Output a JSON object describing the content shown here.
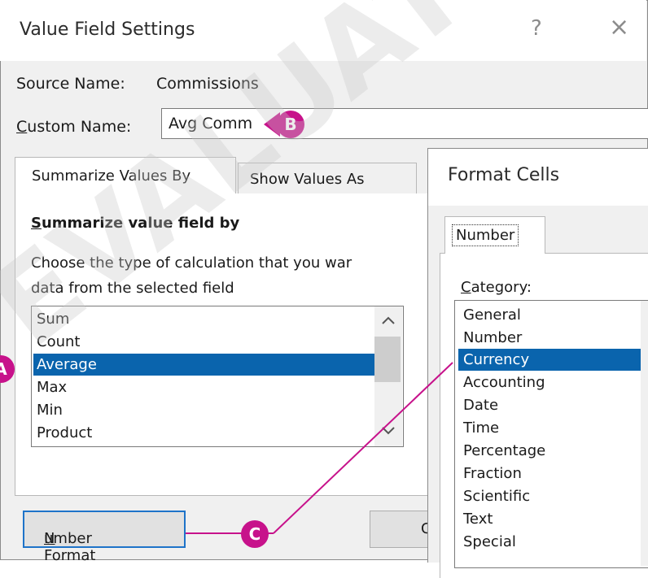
{
  "window": {
    "title": "Value Field Settings",
    "help_glyph": "?",
    "close_glyph": "×"
  },
  "source_row": {
    "label": "Source Name:",
    "value": "Commissions"
  },
  "custom_row": {
    "label_first": "C",
    "label_rest": "ustom Name:",
    "value": "Avg Comm"
  },
  "tabs": [
    {
      "label": "Summarize Values By"
    },
    {
      "label": "Show Values As"
    }
  ],
  "summarize": {
    "heading_first": "S",
    "heading_rest": "ummarize value field by",
    "desc_line1": "Choose the type of calculation that you war",
    "desc_line2": "data from the selected field",
    "items": [
      "Sum",
      "Count",
      "Average",
      "Max",
      "Min",
      "Product"
    ],
    "selected": "Average"
  },
  "buttons": {
    "number_format_first": "N",
    "number_format_rest": "umber Format",
    "ok_partial": "C"
  },
  "format_cells": {
    "title": "Format Cells",
    "tab": "Number",
    "category_first": "C",
    "category_rest": "ategory:",
    "categories": [
      "General",
      "Number",
      "Currency",
      "Accounting",
      "Date",
      "Time",
      "Percentage",
      "Fraction",
      "Scientific",
      "Text",
      "Special"
    ],
    "selected": "Currency"
  },
  "callouts": {
    "a": "A",
    "b": "B",
    "c": "C"
  },
  "colors": {
    "accent": "#c7128b",
    "selection": "#0a64ad",
    "focus_border": "#1e73c9"
  },
  "watermark": "EVALUATION"
}
